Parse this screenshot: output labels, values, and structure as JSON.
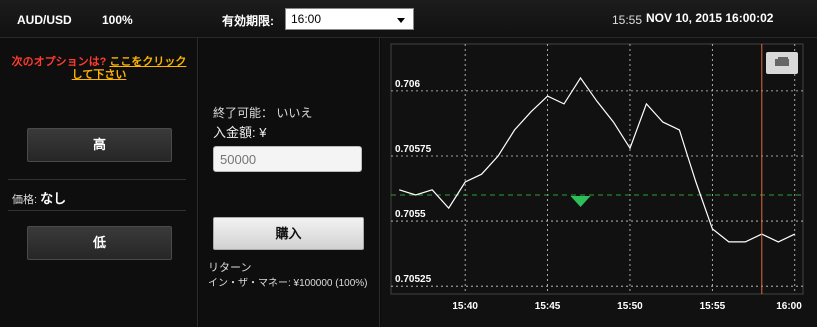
{
  "topbar": {
    "pair": "AUD/USD",
    "payout_pct": "100%",
    "expiry_label": "有効期限:",
    "expiry_selected": "16:00",
    "time_short": "15:55",
    "datetime": "NOV 10, 2015 16:00:02"
  },
  "left": {
    "next_option_question": "次のオプションは?",
    "next_option_link": "ここをクリックして下さい",
    "high_label": "高",
    "price_label": "価格:",
    "price_value": "なし",
    "low_label": "低"
  },
  "middle": {
    "can_close": "終了可能： いいえ",
    "amount_label": "入金額: ¥",
    "amount_placeholder": "50000",
    "buy_label": "購入",
    "return_label": "リターン",
    "in_the_money": "イン・ザ・マネー: ¥100000 (100%)"
  },
  "chart_data": {
    "type": "line",
    "series": [
      {
        "x": [
          "15:36",
          "15:37",
          "15:38",
          "15:39",
          "15:40",
          "15:41",
          "15:42",
          "15:43",
          "15:44",
          "15:45",
          "15:46",
          "15:47",
          "15:48",
          "15:49",
          "15:50",
          "15:51",
          "15:52",
          "15:53",
          "15:53.5",
          "15:54",
          "15:55",
          "15:56",
          "15:57",
          "15:58",
          "15:59",
          "16:00"
        ],
        "values": [
          0.70562,
          0.7056,
          0.70562,
          0.70555,
          0.70565,
          0.70568,
          0.70575,
          0.70585,
          0.70592,
          0.70598,
          0.70595,
          0.70605,
          0.70596,
          0.70588,
          0.70578,
          0.70595,
          0.70588,
          0.70585,
          0.70575,
          0.70565,
          0.70547,
          0.70542,
          0.70542,
          0.70545,
          0.70542,
          0.70545
        ]
      }
    ],
    "strike": 0.7056,
    "y_ticks": [
      "0.706",
      "0.70575",
      "0.7055",
      "0.70525"
    ],
    "x_ticks": [
      "15:40",
      "15:45",
      "15:50",
      "15:55",
      "16:00"
    ],
    "ylim": [
      0.70522,
      0.70618
    ],
    "current_time_marker": "15:58"
  },
  "colors": {
    "line": "#ffffff",
    "strike_line": "#2e9b2e",
    "marker": "#2cbf5a",
    "time_marker": "#e06a3c",
    "grid": "#cfcfcf"
  }
}
